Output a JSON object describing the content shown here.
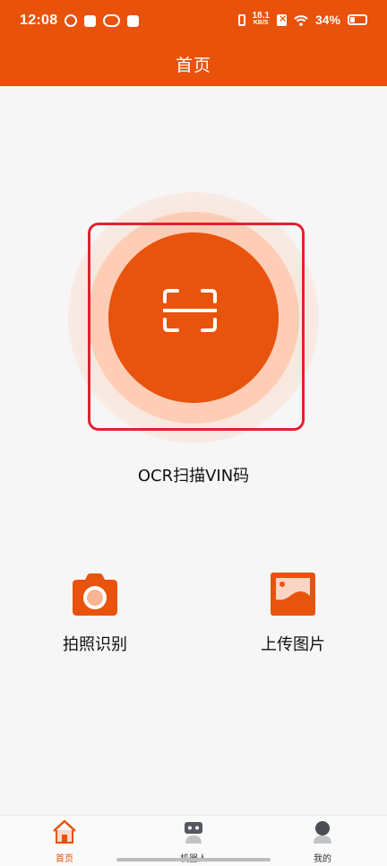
{
  "status_bar": {
    "time": "12:08",
    "net_speed_value": "18.1",
    "net_speed_unit": "KB/S",
    "battery": "34%"
  },
  "header": {
    "title": "首页"
  },
  "main": {
    "scan_label": "OCR扫描VIN码",
    "actions": [
      {
        "label": "拍照识别",
        "icon": "camera-icon"
      },
      {
        "label": "上传图片",
        "icon": "image-icon"
      }
    ]
  },
  "bottom_nav": {
    "items": [
      {
        "label": "首页",
        "icon": "home-icon",
        "active": true
      },
      {
        "label": "机器人",
        "icon": "robot-icon",
        "active": false
      },
      {
        "label": "我的",
        "icon": "user-icon",
        "active": false
      }
    ]
  },
  "colors": {
    "brand": "#e8520b",
    "ring": "#ffcdb5",
    "highlight": "#e02230"
  }
}
